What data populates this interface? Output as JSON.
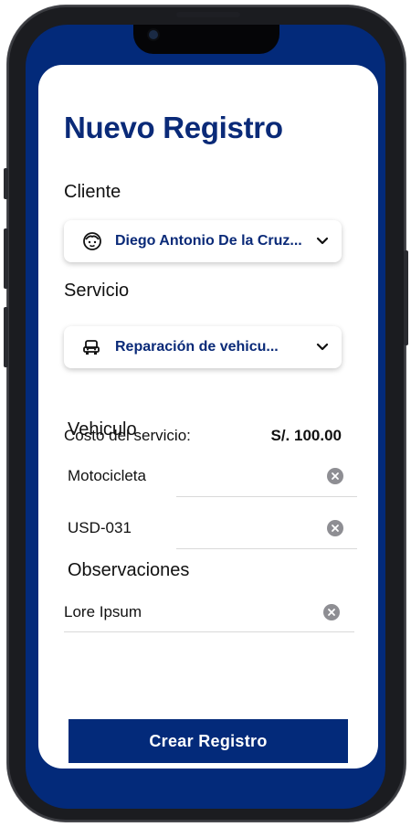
{
  "form": {
    "title": "Nuevo Registro",
    "cliente_label": "Cliente",
    "cliente_value": "Diego Antonio De la Cruz...",
    "servicio_label": "Servicio",
    "servicio_value": "Reparación de vehicu...",
    "costo_label": "Costo del servicio:",
    "costo_value": "S/. 100.00",
    "vehiculo_label": "Vehiculo",
    "vehiculo_tipo": "Motocicleta",
    "vehiculo_placa": "USD-031",
    "observaciones_label": "Observaciones",
    "observaciones_value": "Lore Ipsum",
    "submit_label": "Crear Registro"
  },
  "icons": {
    "cliente": "face-icon",
    "servicio": "car-service-icon",
    "dropdown": "chevron-down-icon",
    "clear": "clear-icon"
  },
  "colors": {
    "brand": "#032a7a",
    "title": "#0a2a78",
    "card": "#ffffff"
  }
}
